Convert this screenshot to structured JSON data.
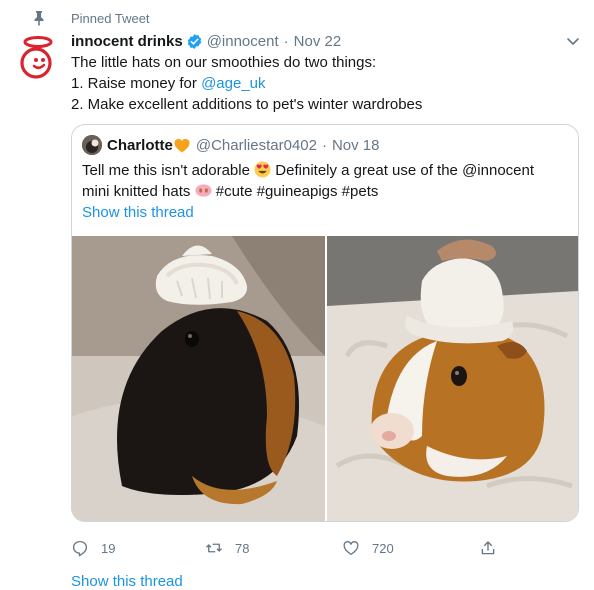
{
  "pinned": {
    "label": "Pinned Tweet"
  },
  "tweet": {
    "display_name": "innocent drinks",
    "handle": "@innocent",
    "separator": "·",
    "date": "Nov 22",
    "text_line1": "The little hats on our smoothies do two things:",
    "text_line2_prefix": "1. Raise money for ",
    "text_line2_link": "@age_uk",
    "text_line3": "2. Make excellent additions to pet's winter wardrobes"
  },
  "quoted": {
    "display_name": "Charlotte",
    "handle": "@Charliestar0402",
    "separator": "·",
    "date": "Nov 18",
    "line1_a": "Tell me this isn't adorable",
    "line1_b": "Definitely a great use of the @innocent",
    "line2_a": "mini knitted hats",
    "line2_b": "#cute #guineapigs #pets",
    "show_thread": "Show this thread"
  },
  "actions": {
    "replies": "19",
    "retweets": "78",
    "likes": "720"
  },
  "footer": {
    "show_thread": "Show this thread"
  },
  "colors": {
    "link": "#1b95e0",
    "muted": "#657786",
    "brand_red": "#d9232e",
    "verified": "#1da1f2"
  },
  "icons": [
    "pin-icon",
    "innocent-logo-icon",
    "verified-icon",
    "chevron-down-icon",
    "heart-emoji-icon",
    "heart-eyes-emoji-icon",
    "pig-nose-emoji-icon",
    "reply-icon",
    "retweet-icon",
    "like-icon",
    "share-icon"
  ]
}
